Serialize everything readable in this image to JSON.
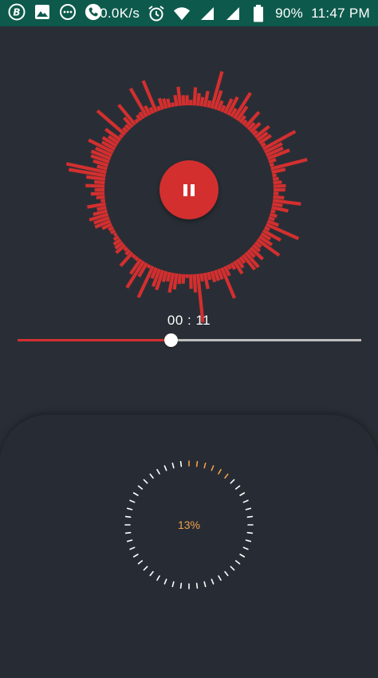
{
  "status_bar": {
    "network_speed": "0.0K/s",
    "battery": "90%",
    "time": "11:47 PM",
    "icons": [
      "b-app-icon",
      "gallery-icon",
      "message-icon",
      "phone-icon",
      "alarm-icon",
      "wifi-icon",
      "signal-icon",
      "signal-icon",
      "battery-icon"
    ]
  },
  "player": {
    "elapsed": "00 : 11",
    "progress": 0.445,
    "state": "playing",
    "play_button_icon": "pause-icon"
  },
  "loader": {
    "percent_label": "13%",
    "progress": 0.13
  },
  "colors": {
    "accent": "#d32f2f",
    "background": "#292e36",
    "status_bar": "#0d5a4c",
    "progress_text": "#f0a04b"
  }
}
